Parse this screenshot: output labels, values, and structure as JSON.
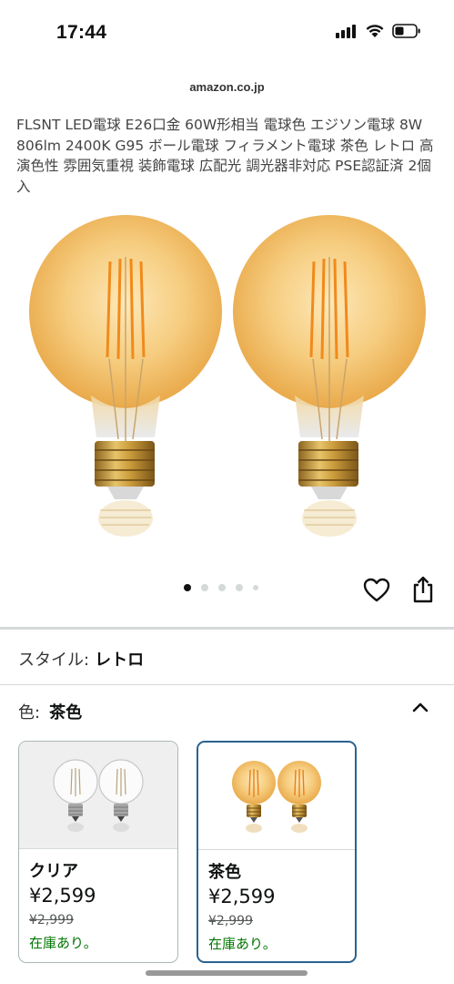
{
  "status": {
    "time": "17:44",
    "icons": [
      "signal-icon",
      "wifi-icon",
      "battery-icon"
    ]
  },
  "browser": {
    "domain": "amazon.co.jp"
  },
  "product": {
    "title": "FLSNT LED電球 E26口金 60W形相当 電球色 エジソン電球 8W 806lm 2400K G95 ボール電球 フィラメント電球 茶色 レトロ 高演色性 雰囲気重視 装飾電球 広配光 調光器非対応 PSE認証済 2個入",
    "image_count": 5,
    "active_image": 1
  },
  "actions": {
    "icons": [
      "heart-icon",
      "share-icon"
    ]
  },
  "style": {
    "label": "スタイル:",
    "value": "レトロ"
  },
  "color": {
    "label": "色:",
    "value": "茶色",
    "expanded_icon": "chevron-up-icon",
    "options": [
      {
        "name": "クリア",
        "price": "¥2,599",
        "list_price": "¥2,999",
        "stock": "在庫あり。",
        "selected": false
      },
      {
        "name": "茶色",
        "price": "¥2,599",
        "list_price": "¥2,999",
        "stock": "在庫あり。",
        "selected": true
      }
    ]
  },
  "colors": {
    "stock_green": "#007600",
    "selected_border": "#2a628f",
    "amber": "#f4c46a",
    "base_gold": "#c89b3c"
  }
}
